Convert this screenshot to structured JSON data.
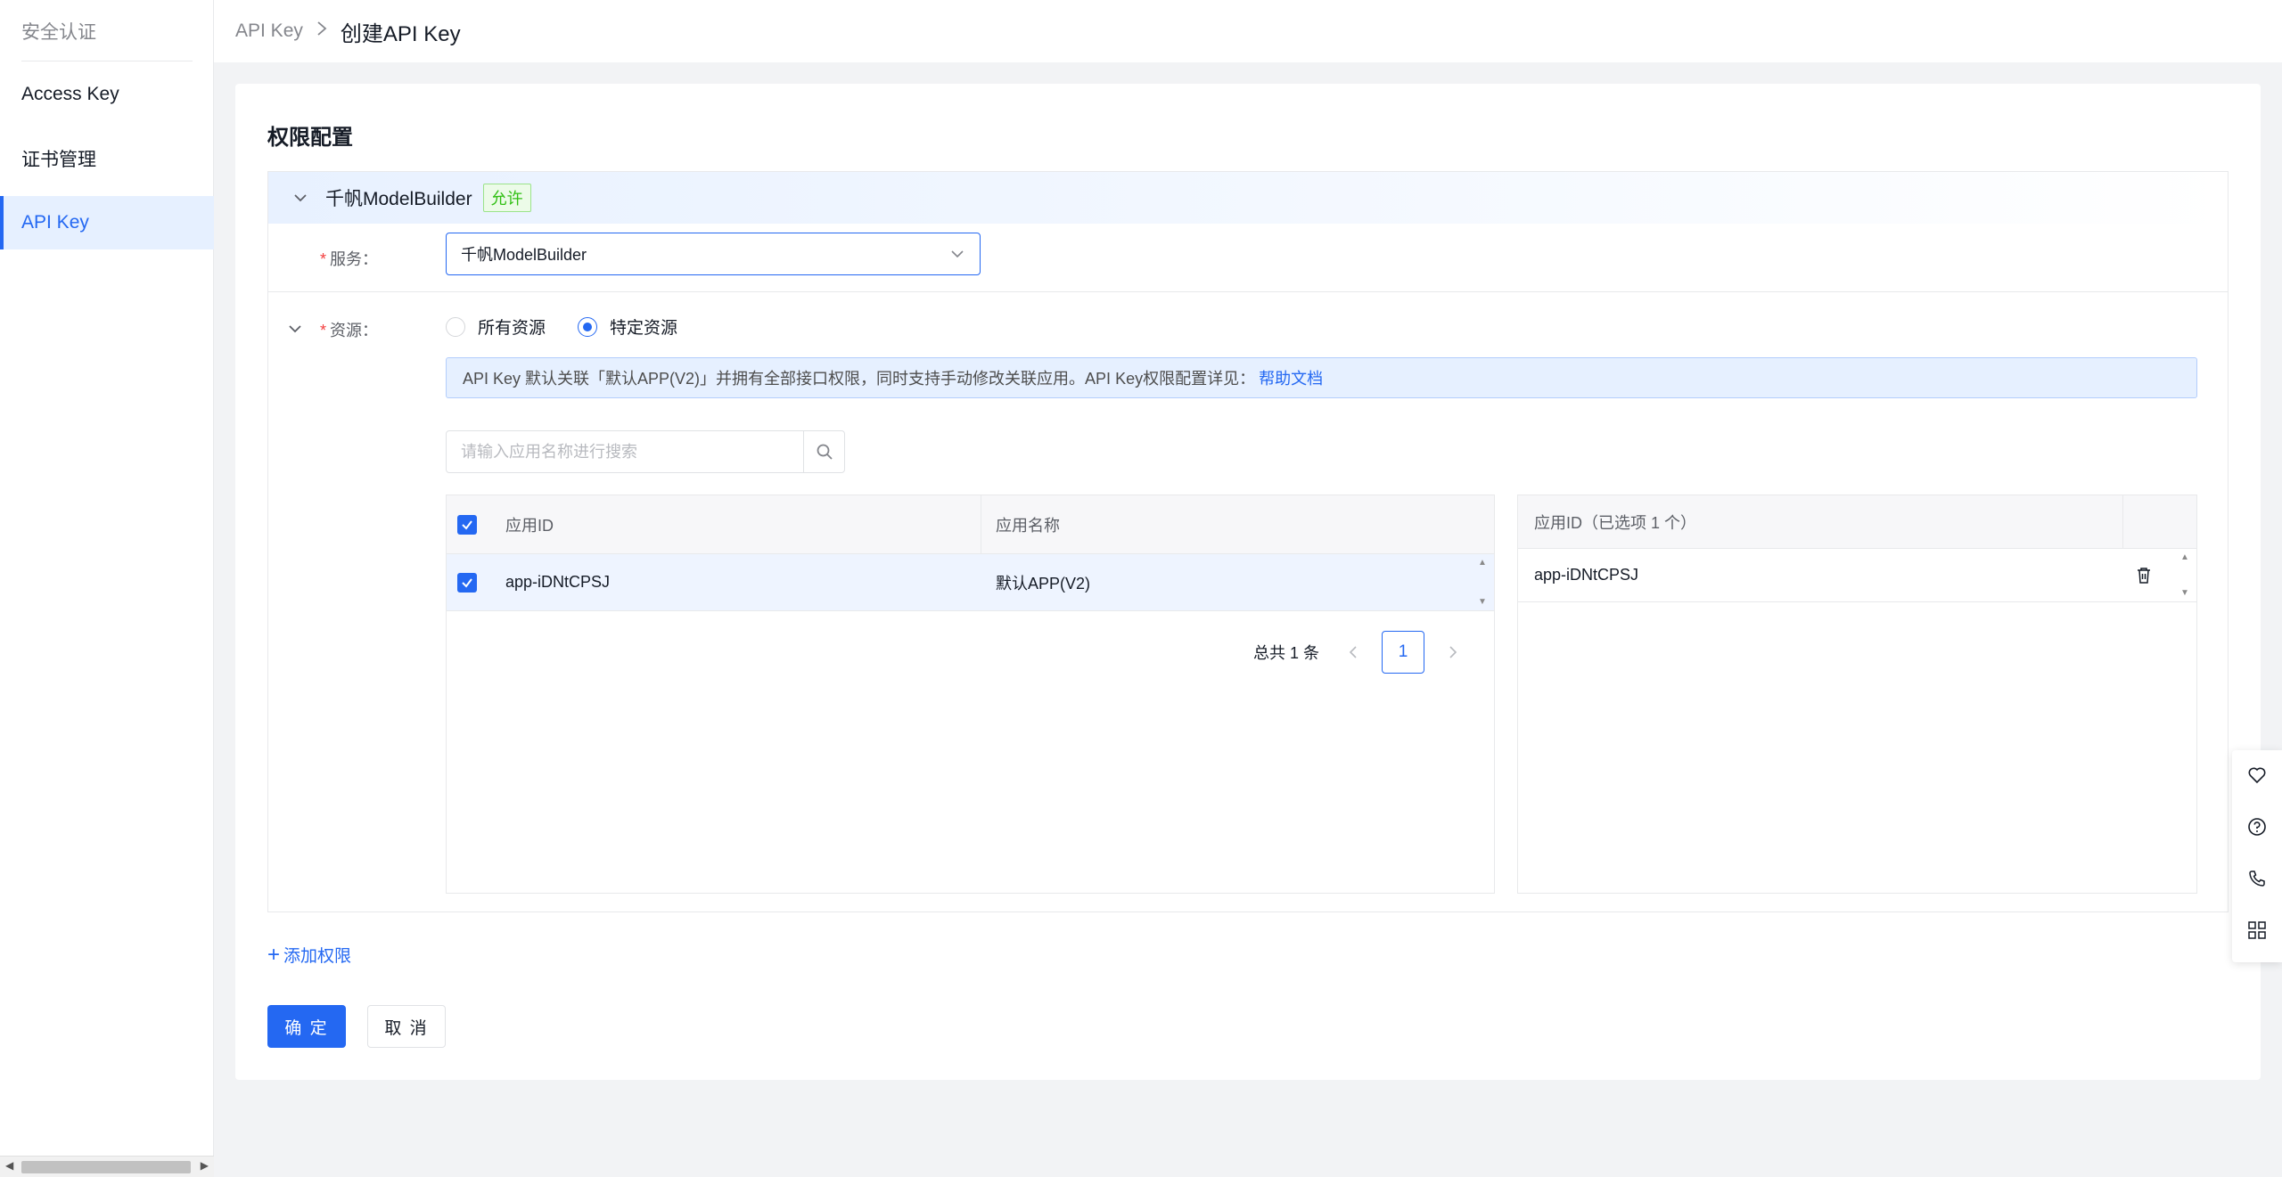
{
  "sidebar": {
    "section_title": "安全认证",
    "items": [
      {
        "label": "Access Key"
      },
      {
        "label": "证书管理"
      },
      {
        "label": "API Key"
      }
    ]
  },
  "breadcrumb": {
    "parent": "API Key",
    "current": "创建API Key"
  },
  "form": {
    "title": "权限配置",
    "permission": {
      "name": "千帆ModelBuilder",
      "badge": "允许",
      "service_label": "服务：",
      "service_value": "千帆ModelBuilder",
      "resource_label": "资源：",
      "resource_options": [
        {
          "label": "所有资源",
          "checked": false
        },
        {
          "label": "特定资源",
          "checked": true
        }
      ],
      "notice_text": "API Key 默认关联「默认APP(V2)」并拥有全部接口权限，同时支持手动修改关联应用。API Key权限配置详见：",
      "notice_link": "帮助文档",
      "search_placeholder": "请输入应用名称进行搜索"
    },
    "table": {
      "columns": [
        "应用ID",
        "应用名称"
      ],
      "rows": [
        {
          "app_id": "app-iDNtCPSJ",
          "app_name": "默认APP(V2)",
          "checked": true
        }
      ],
      "pager": {
        "total": "总共 1 条",
        "current_page": "1"
      }
    },
    "selected": {
      "header": "应用ID（已选项 1 个）",
      "items": [
        "app-iDNtCPSJ"
      ]
    },
    "add_permission": "添加权限",
    "confirm": "确 定",
    "cancel": "取 消"
  },
  "colors": {
    "primary": "#2468f2",
    "success": "#30bf13",
    "required": "#f33e3e"
  }
}
